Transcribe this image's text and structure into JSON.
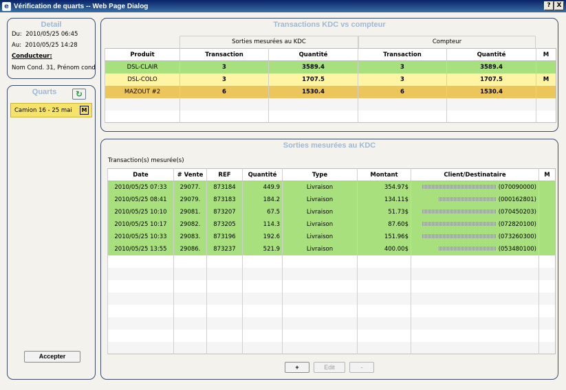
{
  "window": {
    "title": "Vérification de quarts -- Web Page Dialog",
    "help_label": "?",
    "close_label": "X"
  },
  "detail": {
    "title": "Detail",
    "du_label": "Du:",
    "du_value": "2010/05/25 06:45",
    "au_label": "Au:",
    "au_value": "2010/05/25 14:28",
    "conducteur_label": "Conducteur:",
    "conducteur_value": "Nom Cond. 31, Prénom cond."
  },
  "quarts": {
    "title": "Quarts",
    "refresh_icon": "refresh-icon",
    "items": [
      {
        "label": "Camion 16 - 25 mai",
        "badge": "M"
      }
    ],
    "accept_label": "Accepter"
  },
  "summary": {
    "title": "Transactions KDC vs compteur",
    "group_sorties": "Sorties mesurées au KDC",
    "group_compteur": "Compteur",
    "headers": [
      "Produit",
      "Transaction",
      "Quantité",
      "Transaction",
      "Quantité",
      "M"
    ],
    "rows": [
      {
        "cells": [
          "DSL-CLAIR",
          "3",
          "3589.4",
          "3",
          "3589.4",
          ""
        ],
        "color": "#a8e07e"
      },
      {
        "cells": [
          "DSL-COLO",
          "3",
          "1707.5",
          "3",
          "1707.5",
          "M"
        ],
        "color": "#fdf5a4"
      },
      {
        "cells": [
          "MAZOUT #2",
          "6",
          "1530.4",
          "6",
          "1530.4",
          ""
        ],
        "color": "#ecc55b"
      }
    ]
  },
  "sorties": {
    "title": "Sorties mesurées au KDC",
    "subtitle": "Transaction(s) mesurée(s)",
    "headers": [
      "Date",
      "# Vente",
      "REF",
      "Quantité",
      "Type",
      "Montant",
      "Client/Destinataire",
      "M"
    ],
    "row_color": "#a8e07e",
    "rows": [
      [
        "2010/05/25 07:33",
        "29077.",
        "873184",
        "449.9",
        "Livraison",
        "354.97$",
        "(070090000)",
        ""
      ],
      [
        "2010/05/25 08:41",
        "29079.",
        "873183",
        "184.2",
        "Livraison",
        "134.11$",
        "(000162801)",
        ""
      ],
      [
        "2010/05/25 10:10",
        "29081.",
        "873207",
        "67.5",
        "Livraison",
        "51.73$",
        "(070450203)",
        ""
      ],
      [
        "2010/05/25 10:17",
        "29082.",
        "873205",
        "114.3",
        "Livraison",
        "87.60$",
        "(072820100)",
        ""
      ],
      [
        "2010/05/25 10:33",
        "29083.",
        "873196",
        "192.6",
        "Livraison",
        "151.96$",
        "(073260300)",
        ""
      ],
      [
        "2010/05/25 13:55",
        "29086.",
        "873237",
        "521.9",
        "Livraison",
        "400.00$",
        "(053480100)",
        ""
      ]
    ],
    "add_label": "+",
    "edit_label": "Edit",
    "remove_label": "-"
  }
}
